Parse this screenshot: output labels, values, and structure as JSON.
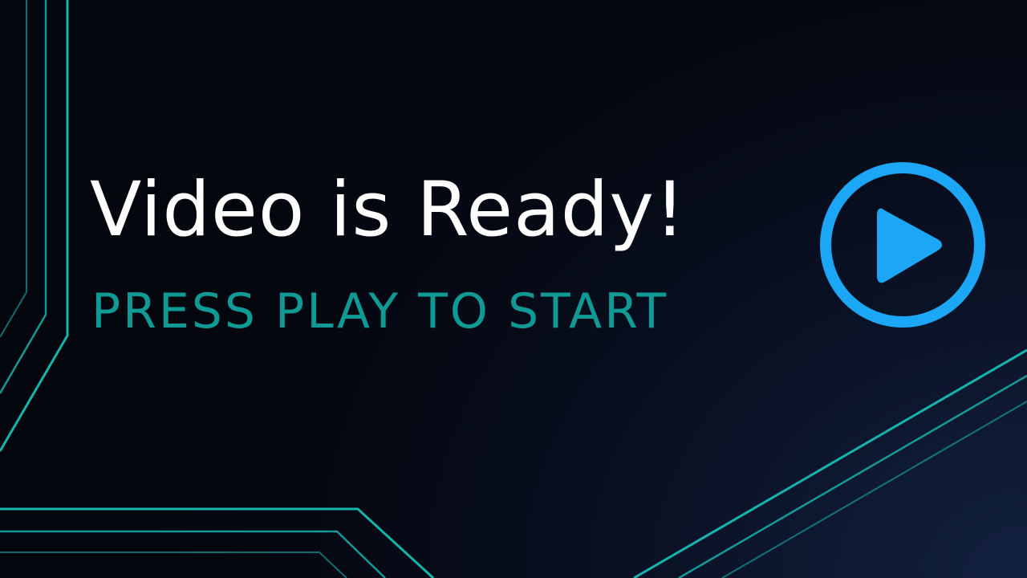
{
  "title": "Video is Ready!",
  "subtitle": "PRESS PLAY TO START",
  "play_button": {
    "icon": "play-icon",
    "aria_label": "Play video"
  },
  "colors": {
    "title": "#ffffff",
    "subtitle": "#0f9a96",
    "accent_line": "#17b3ad",
    "play_icon": "#1ba7f5",
    "background_dark": "#04060d",
    "background_glow": "#13213f"
  }
}
